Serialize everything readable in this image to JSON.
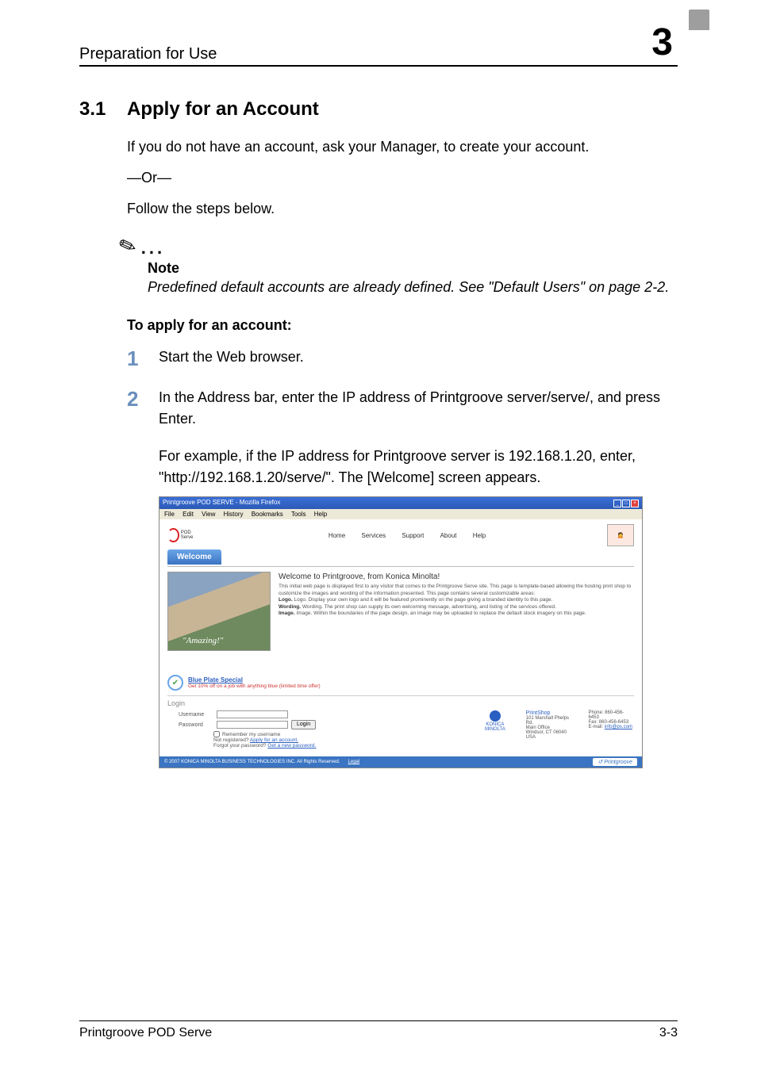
{
  "header": {
    "title": "Preparation for Use",
    "chapter": "3"
  },
  "section": {
    "number": "3.1",
    "title": "Apply for an Account"
  },
  "intro": {
    "p1": "If you do not have an account, ask your Manager, to create your account.",
    "or": "—Or—",
    "p2": "Follow the steps below."
  },
  "note": {
    "heading": "Note",
    "text": "Predefined default accounts are already defined. See \"Default Users\" on page 2-2."
  },
  "apply_heading": "To apply for an account:",
  "steps": {
    "s1": {
      "num": "1",
      "text": "Start the Web browser."
    },
    "s2": {
      "num": "2",
      "text": "In the Address bar, enter the IP address of Printgroove server/serve/, and press Enter."
    },
    "s2b": "For example, if the IP address for Printgroove server is 192.168.1.20, enter, \"http://192.168.1.20/serve/\". The [Welcome] screen appears."
  },
  "screenshot": {
    "window_title": "Printgroove POD SERVE - Mozilla Firefox",
    "menu": {
      "file": "File",
      "edit": "Edit",
      "view": "View",
      "history": "History",
      "bookmarks": "Bookmarks",
      "tools": "Tools",
      "help": "Help"
    },
    "nav": {
      "home": "Home",
      "services": "Services",
      "support": "Support",
      "about": "About",
      "help": "Help"
    },
    "logo_text": "POD Serve",
    "tab": "Welcome",
    "content": {
      "heading": "Welcome to Printgroove, from Konica Minolta!",
      "p": "This initial web page is displayed first to any visitor that comes to the Printgroove Serve site. This page is template-based allowing the hosting print shop to customize the images and wording of the information presented. This page contains several customizable areas:",
      "logo_line": "Logo. Display your own logo and it will be featured prominently on the page giving a branded identity to this page.",
      "wording_line": "Wording. The print shop can supply its own welcoming message, advertising, and listing of the services offered.",
      "image_line": "Image. Within the boundaries of the page design, an image may be uploaded to replace the default stock imagery on this page.",
      "amazing": "\"Amazing!\""
    },
    "blue_plate": {
      "title": "Blue Plate Special",
      "sub": "Get 10% off on a job with anything blue (limited time offer)"
    },
    "login": {
      "heading": "Login",
      "username_label": "Username",
      "password_label": "Password",
      "login_btn": "Login",
      "remember": "Remember my username",
      "not_registered_pre": "Not registered?  ",
      "not_registered_link": "Apply for an account.",
      "forgot_pre": "Forgot your password?  ",
      "forgot_link": "Get a new password."
    },
    "right": {
      "brand": "KONICA MINOLTA",
      "shop_title": "PrintShop",
      "addr1": "101 Marshall Phelps Rd.",
      "addr2": "Main Office",
      "addr3": "Windsor, CT 06040",
      "addr4": "USA",
      "phone": "Phone: 860-456-6453",
      "fax": "Fax: 860-456-6453",
      "email_label": "E-mail: ",
      "email": "info@ps.com"
    },
    "footer": {
      "copy": "© 2007 KONICA MINOLTA BUSINESS TECHNOLOGIES INC. All Rights Reserved.",
      "legal": "Legal",
      "brand": "Printgroove"
    }
  },
  "footer": {
    "product": "Printgroove POD Serve",
    "page": "3-3"
  }
}
